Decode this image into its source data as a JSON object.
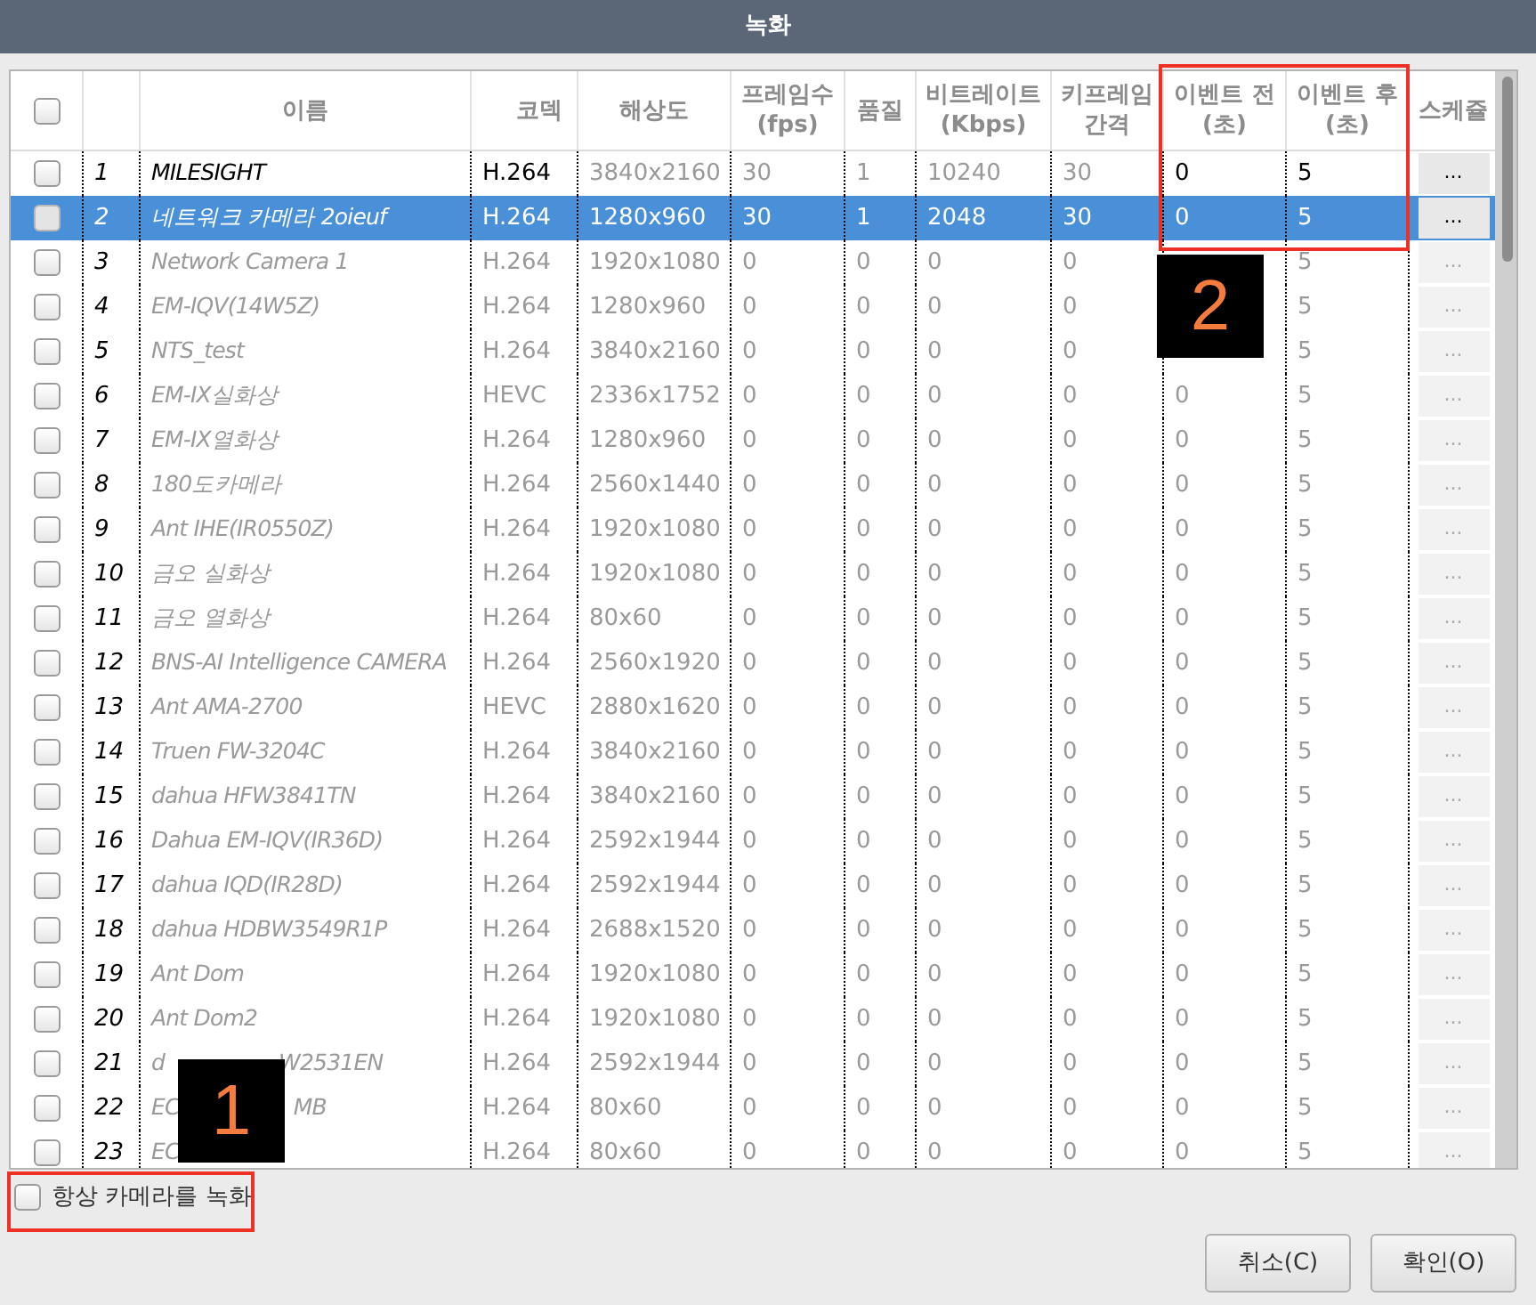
{
  "window": {
    "title": "녹화"
  },
  "table": {
    "select_all": {
      "checked": false
    },
    "columns": [
      "이름",
      "코덱",
      "해상도",
      "프레임수\n(fps)",
      "품질",
      "비트레이트\n(Kbps)",
      "키프레임\n간격",
      "이벤트 전\n(초)",
      "이벤트 후\n(초)",
      "스케쥴"
    ],
    "rows": [
      {
        "checked": false,
        "selected": false,
        "enabled": true,
        "number": "1",
        "name": "MILESIGHT",
        "values": [
          "H.264",
          "3840x2160",
          "30",
          "1",
          "10240",
          "30",
          "0",
          "5"
        ],
        "schedule": "..."
      },
      {
        "checked": false,
        "selected": true,
        "enabled": true,
        "number": "2",
        "name": "네트워크 카메라 2oieuf",
        "values": [
          "H.264",
          "1280x960",
          "30",
          "1",
          "2048",
          "30",
          "0",
          "5"
        ],
        "schedule": "..."
      },
      {
        "checked": false,
        "selected": false,
        "enabled": false,
        "number": "3",
        "name": "Network Camera 1",
        "values": [
          "H.264",
          "1920x1080",
          "0",
          "0",
          "0",
          "0"
        ],
        "event_post": "5",
        "schedule": "..."
      },
      {
        "checked": false,
        "selected": false,
        "enabled": false,
        "number": "4",
        "name": "EM-IQV(14W5Z)",
        "values": [
          "H.264",
          "1280x960",
          "0",
          "0",
          "0",
          "0"
        ],
        "event_post": "5",
        "schedule": "..."
      },
      {
        "checked": false,
        "selected": false,
        "enabled": false,
        "number": "5",
        "name": "NTS_test",
        "values": [
          "H.264",
          "3840x2160",
          "0",
          "0",
          "0",
          "0"
        ],
        "event_post": "5",
        "schedule": "..."
      },
      {
        "checked": false,
        "selected": false,
        "enabled": false,
        "number": "6",
        "name": "EM-IX실화상",
        "values": [
          "HEVC",
          "2336x1752",
          "0",
          "0",
          "0",
          "0",
          "0",
          "5"
        ],
        "schedule": "..."
      },
      {
        "checked": false,
        "selected": false,
        "enabled": false,
        "number": "7",
        "name": "EM-IX열화상",
        "values": [
          "H.264",
          "1280x960",
          "0",
          "0",
          "0",
          "0",
          "0",
          "5"
        ],
        "schedule": "..."
      },
      {
        "checked": false,
        "selected": false,
        "enabled": false,
        "number": "8",
        "name": "180도카메라",
        "values": [
          "H.264",
          "2560x1440",
          "0",
          "0",
          "0",
          "0",
          "0",
          "5"
        ],
        "schedule": "..."
      },
      {
        "checked": false,
        "selected": false,
        "enabled": false,
        "number": "9",
        "name": "Ant IHE(IR0550Z)",
        "values": [
          "H.264",
          "1920x1080",
          "0",
          "0",
          "0",
          "0",
          "0",
          "5"
        ],
        "schedule": "..."
      },
      {
        "checked": false,
        "selected": false,
        "enabled": false,
        "number": "10",
        "name": "금오 실화상",
        "values": [
          "H.264",
          "1920x1080",
          "0",
          "0",
          "0",
          "0",
          "0",
          "5"
        ],
        "schedule": "..."
      },
      {
        "checked": false,
        "selected": false,
        "enabled": false,
        "number": "11",
        "name": "금오 열화상",
        "values": [
          "H.264",
          "80x60",
          "0",
          "0",
          "0",
          "0",
          "0",
          "5"
        ],
        "schedule": "..."
      },
      {
        "checked": false,
        "selected": false,
        "enabled": false,
        "number": "12",
        "name": "BNS-AI Intelligence CAMERA",
        "values": [
          "H.264",
          "2560x1920",
          "0",
          "0",
          "0",
          "0",
          "0",
          "5"
        ],
        "schedule": "..."
      },
      {
        "checked": false,
        "selected": false,
        "enabled": false,
        "number": "13",
        "name": "Ant AMA-2700",
        "values": [
          "HEVC",
          "2880x1620",
          "0",
          "0",
          "0",
          "0",
          "0",
          "5"
        ],
        "schedule": "..."
      },
      {
        "checked": false,
        "selected": false,
        "enabled": false,
        "number": "14",
        "name": "Truen FW-3204C",
        "values": [
          "H.264",
          "3840x2160",
          "0",
          "0",
          "0",
          "0",
          "0",
          "5"
        ],
        "schedule": "..."
      },
      {
        "checked": false,
        "selected": false,
        "enabled": false,
        "number": "15",
        "name": "dahua HFW3841TN",
        "values": [
          "H.264",
          "3840x2160",
          "0",
          "0",
          "0",
          "0",
          "0",
          "5"
        ],
        "schedule": "..."
      },
      {
        "checked": false,
        "selected": false,
        "enabled": false,
        "number": "16",
        "name": "Dahua EM-IQV(IR36D)",
        "values": [
          "H.264",
          "2592x1944",
          "0",
          "0",
          "0",
          "0",
          "0",
          "5"
        ],
        "schedule": "..."
      },
      {
        "checked": false,
        "selected": false,
        "enabled": false,
        "number": "17",
        "name": "dahua IQD(IR28D)",
        "values": [
          "H.264",
          "2592x1944",
          "0",
          "0",
          "0",
          "0",
          "0",
          "5"
        ],
        "schedule": "..."
      },
      {
        "checked": false,
        "selected": false,
        "enabled": false,
        "number": "18",
        "name": "dahua HDBW3549R1P",
        "values": [
          "H.264",
          "2688x1520",
          "0",
          "0",
          "0",
          "0",
          "0",
          "5"
        ],
        "schedule": "..."
      },
      {
        "checked": false,
        "selected": false,
        "enabled": false,
        "number": "19",
        "name": "Ant Dom",
        "values": [
          "H.264",
          "1920x1080",
          "0",
          "0",
          "0",
          "0",
          "0",
          "5"
        ],
        "schedule": "..."
      },
      {
        "checked": false,
        "selected": false,
        "enabled": false,
        "number": "20",
        "name": "Ant Dom2",
        "values": [
          "H.264",
          "1920x1080",
          "0",
          "0",
          "0",
          "0",
          "0",
          "5"
        ],
        "schedule": "..."
      },
      {
        "checked": false,
        "selected": false,
        "enabled": false,
        "number": "21",
        "name": "d",
        "name_after": "W2531EN",
        "values": [
          "H.264",
          "2592x1944",
          "0",
          "0",
          "0",
          "0",
          "0",
          "5"
        ],
        "schedule": "..."
      },
      {
        "checked": false,
        "selected": false,
        "enabled": false,
        "number": "22",
        "name": "EC",
        "name_after": "MB",
        "values": [
          "H.264",
          "80x60",
          "0",
          "0",
          "0",
          "0",
          "0",
          "5"
        ],
        "schedule": "..."
      },
      {
        "checked": false,
        "selected": false,
        "enabled": false,
        "number": "23",
        "name": "EC",
        "values": [
          "H.264",
          "80x60",
          "0",
          "0",
          "0",
          "0",
          "0",
          "5"
        ],
        "schedule": "..."
      }
    ]
  },
  "always_record": {
    "label": "항상 카메라를 녹화",
    "checked": false
  },
  "buttons": [
    {
      "label": "취소(C)"
    },
    {
      "label": "확인(O)"
    }
  ],
  "annotations": [
    {
      "kind": "frame"
    },
    {
      "kind": "frame"
    },
    {
      "kind": "badge",
      "number": "1"
    },
    {
      "kind": "badge",
      "number": "2"
    }
  ]
}
